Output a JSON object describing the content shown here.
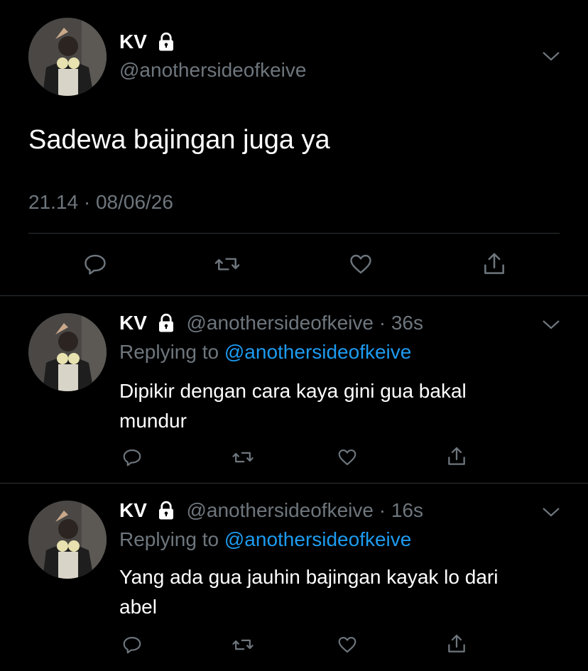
{
  "main_tweet": {
    "display_name": "KV",
    "handle": "@anothersideofkeive",
    "text": "Sadewa bajingan juga ya",
    "timestamp": "21.14 · 08/06/26"
  },
  "replies": [
    {
      "display_name": "KV",
      "handle": "@anothersideofkeive",
      "age": "· 36s",
      "replying_prefix": "Replying to",
      "replying_to": "@anothersideofkeive",
      "text_line1": "Dipikir dengan cara kaya gini gua bakal",
      "text_line2": "mundur"
    },
    {
      "display_name": "KV",
      "handle": "@anothersideofkeive",
      "age": "· 16s",
      "replying_prefix": "Replying to",
      "replying_to": "@anothersideofkeive",
      "text_line1": "Yang ada gua jauhin bajingan kayak lo dari",
      "text_line2": "abel"
    }
  ],
  "icons": {
    "lock": "lock-icon",
    "menu": "chevron-down-icon",
    "reply": "reply-icon",
    "retweet": "retweet-icon",
    "like": "heart-icon",
    "share": "share-icon"
  },
  "colors": {
    "background": "#000000",
    "text": "#ffffff",
    "secondary": "#6e767d",
    "link": "#1d9bf0",
    "divider": "#2f3336"
  }
}
